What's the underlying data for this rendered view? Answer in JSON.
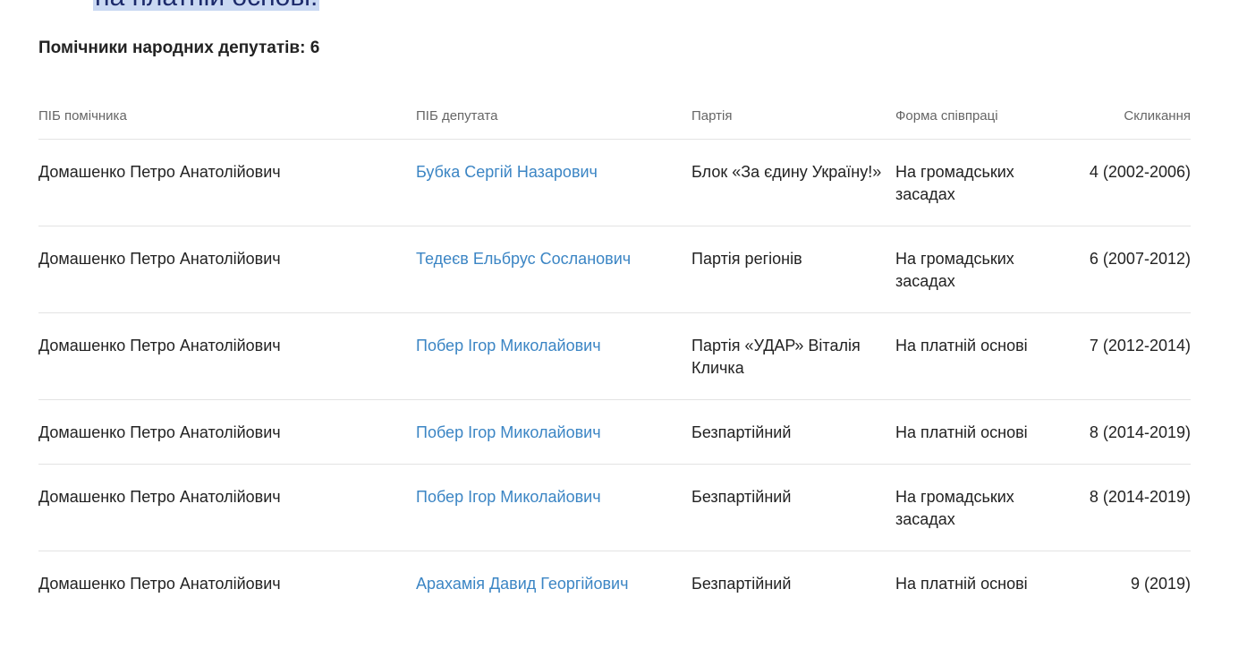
{
  "top_snippet": "на платній основі.",
  "section_title": "Помічники народних депутатів: 6",
  "columns": {
    "assistant": "ПІБ помічника",
    "deputy": "ПІБ депутата",
    "party": "Партія",
    "cooperation": "Форма співпраці",
    "convocation": "Скликання"
  },
  "rows": [
    {
      "assistant": "Домашенко Петро Анатолійович",
      "deputy": "Бубка Сергій Назарович",
      "party": "Блок «За єдину Україну!»",
      "cooperation": "На громадських засадах",
      "convocation": "4 (2002-2006)"
    },
    {
      "assistant": "Домашенко Петро Анатолійович",
      "deputy": "Тедеєв Ельбрус Сосланович",
      "party": "Партія регіонів",
      "cooperation": "На громадських засадах",
      "convocation": "6 (2007-2012)"
    },
    {
      "assistant": "Домашенко Петро Анатолійович",
      "deputy": "Побер Ігор Миколайович",
      "party": "Партія «УДАР» Віталія Кличка",
      "cooperation": "На платній основі",
      "convocation": "7 (2012-2014)"
    },
    {
      "assistant": "Домашенко Петро Анатолійович",
      "deputy": "Побер Ігор Миколайович",
      "party": "Безпартійний",
      "cooperation": "На платній основі",
      "convocation": "8 (2014-2019)"
    },
    {
      "assistant": "Домашенко Петро Анатолійович",
      "deputy": "Побер Ігор Миколайович",
      "party": "Безпартійний",
      "cooperation": "На громадських засадах",
      "convocation": "8 (2014-2019)"
    },
    {
      "assistant": "Домашенко Петро Анатолійович",
      "deputy": "Арахамія Давид Георгійович",
      "party": "Безпартійний",
      "cooperation": "На платній основі",
      "convocation": "9 (2019)"
    }
  ]
}
